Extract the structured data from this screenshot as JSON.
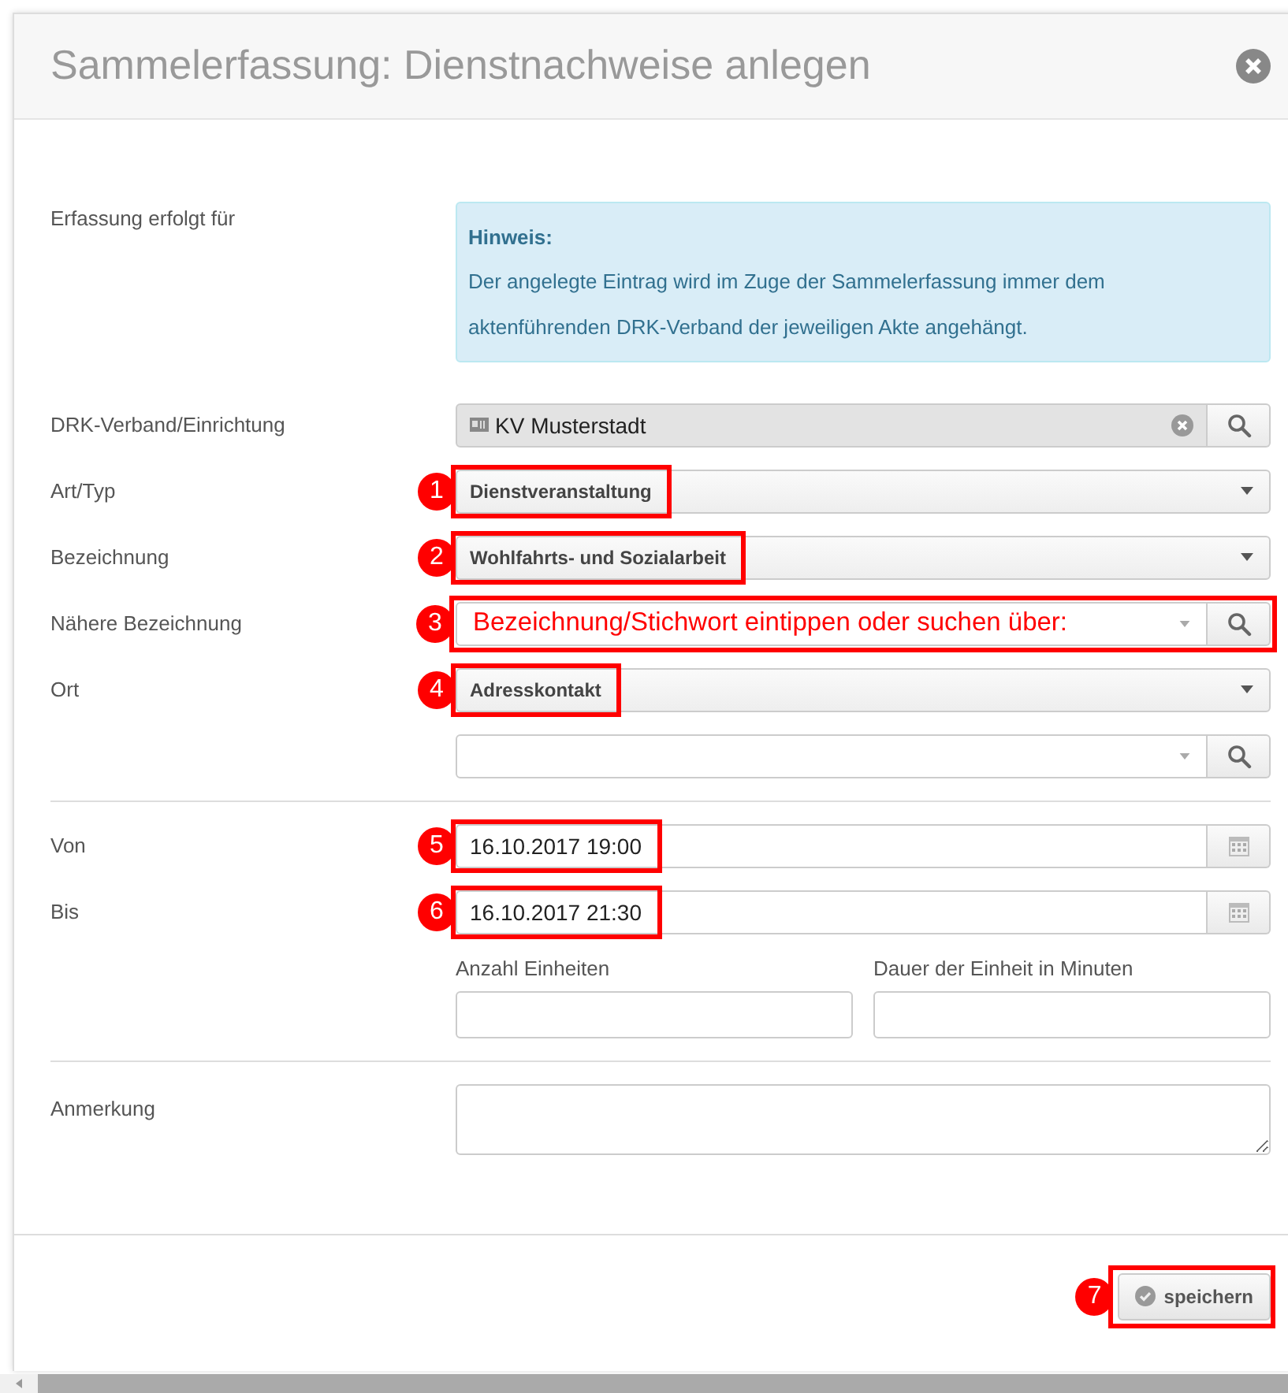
{
  "dialog": {
    "title": "Sammelerfassung: Dienstnachweise anlegen"
  },
  "notice": {
    "label": "Erfassung erfolgt für",
    "heading": "Hinweis:",
    "text": "Der angelegte Eintrag wird im Zuge der Sammelerfassung immer dem aktenführenden DRK-Verband der jeweiligen Akte angehängt."
  },
  "fields": [
    {
      "kind": "lookup",
      "label": "DRK-Verband/Einrichtung",
      "value": "KV Musterstadt"
    },
    {
      "kind": "select",
      "label": "Art/Typ",
      "value": "Dienstveranstaltung",
      "callout": {
        "number": "1",
        "kind": "value"
      }
    },
    {
      "kind": "select",
      "label": "Bezeichnung",
      "value": "Wohlfahrts- und Sozialarbeit",
      "callout": {
        "number": "2",
        "kind": "value"
      }
    },
    {
      "kind": "combo",
      "label": "Nähere Bezeichnung",
      "hint": "Bezeichnung/Stichwort eintippen oder suchen über:",
      "callout": {
        "number": "3",
        "kind": "field"
      }
    },
    {
      "kind": "select",
      "label": "Ort",
      "value": "Adresskontakt",
      "callout": {
        "number": "4",
        "kind": "value"
      }
    },
    {
      "kind": "combo"
    },
    {
      "kind": "divider"
    },
    {
      "kind": "date",
      "label": "Von",
      "value": "16.10.2017 19:00",
      "callout": {
        "number": "5",
        "kind": "value"
      }
    },
    {
      "kind": "date",
      "label": "Bis",
      "value": "16.10.2017 21:30",
      "callout": {
        "number": "6",
        "kind": "value"
      }
    },
    {
      "kind": "pair",
      "inputs": [
        {
          "label": "Anzahl Einheiten"
        },
        {
          "label": "Dauer der Einheit in Minuten"
        }
      ]
    },
    {
      "kind": "divider"
    },
    {
      "kind": "textarea",
      "label": "Anmerkung"
    }
  ],
  "footer": {
    "buttons": [
      {
        "label": "speichern",
        "callout": {
          "number": "7",
          "kind": "field"
        }
      }
    ]
  }
}
